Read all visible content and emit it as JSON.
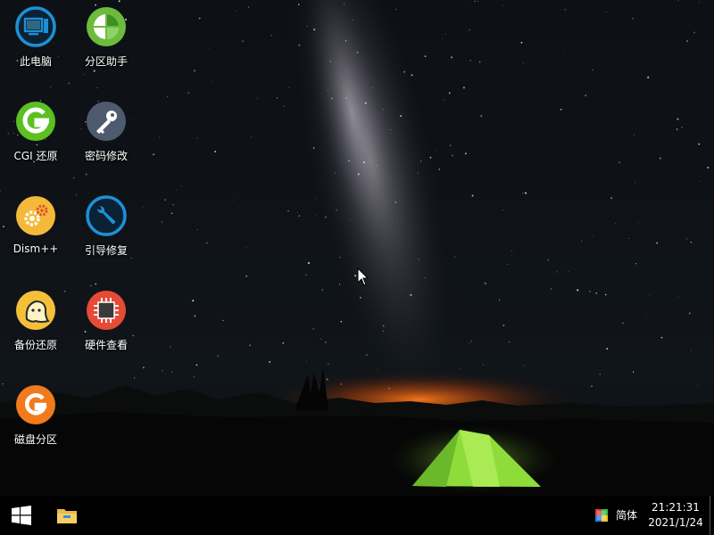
{
  "desktop_icons": [
    {
      "label": "此电脑"
    },
    {
      "label": "分区助手"
    },
    {
      "label": "CGI 还原"
    },
    {
      "label": "密码修改"
    },
    {
      "label": "Dism++"
    },
    {
      "label": "引导修复"
    },
    {
      "label": "备份还原"
    },
    {
      "label": "硬件查看"
    },
    {
      "label": "磁盘分区"
    }
  ],
  "taskbar": {
    "start_icon": "windows-logo-icon",
    "pinned": [
      {
        "icon": "file-explorer-icon"
      }
    ],
    "tray": {
      "ime_icon": "input-method-icon",
      "language_label": "简体",
      "time": "21:21:31",
      "date": "2021/1/24"
    }
  },
  "colors": {
    "accent": "#1e8fd6",
    "cgi_green": "#5cbf22",
    "partition_orange": "#f07a1c",
    "backup_yellow": "#f4c03a",
    "hardware_red": "#e54b36",
    "tent_green": "#8edc3a"
  }
}
